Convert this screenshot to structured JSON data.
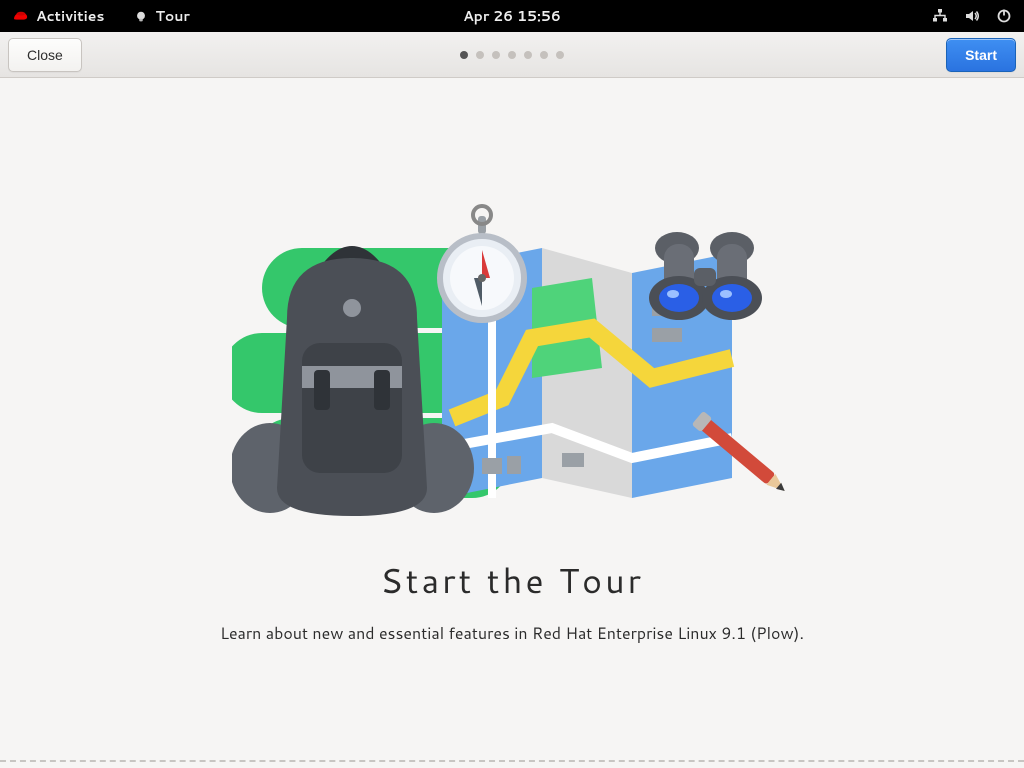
{
  "panel": {
    "activities_label": "Activities",
    "app_label": "Tour",
    "clock": "Apr 26  15:56"
  },
  "tour": {
    "close_label": "Close",
    "start_label": "Start",
    "page_current_index": 0,
    "page_count": 7,
    "title": "Start the Tour",
    "subtitle": "Learn about new and essential features in Red Hat Enterprise Linux 9.1 (Plow)."
  }
}
